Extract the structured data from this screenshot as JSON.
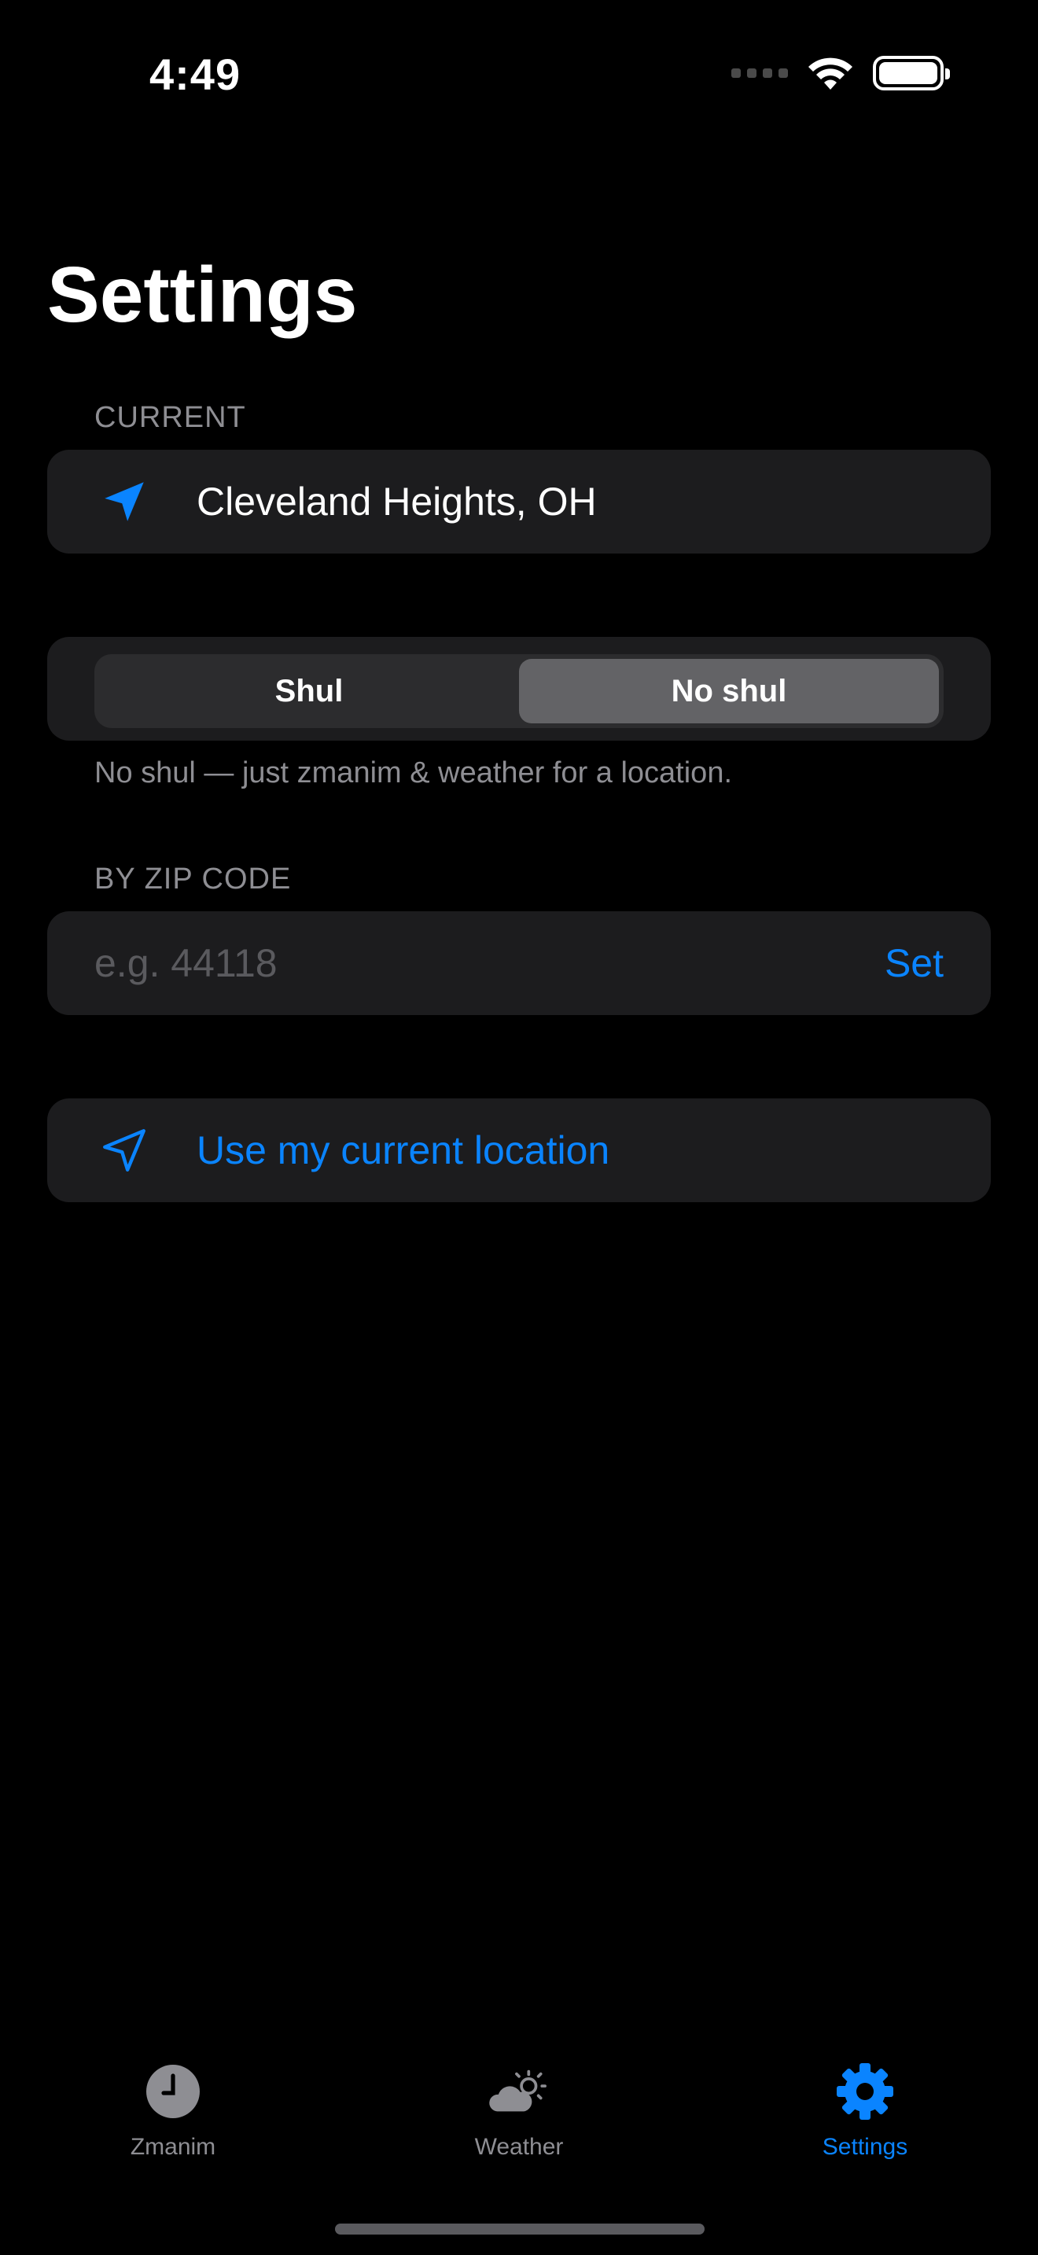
{
  "status_bar": {
    "time": "4:49"
  },
  "page": {
    "title": "Settings"
  },
  "current_section": {
    "label": "CURRENT",
    "location": "Cleveland Heights, OH",
    "icon": "location-arrow-filled-icon"
  },
  "mode": {
    "options": [
      "Shul",
      "No shul"
    ],
    "selected": "No shul",
    "helper": "No shul — just zmanim & weather for a location."
  },
  "zip_section": {
    "label": "BY ZIP CODE",
    "value": "",
    "placeholder": "e.g. 44118",
    "set_label": "Set"
  },
  "use_location": {
    "label": "Use my current location",
    "icon": "location-arrow-outline-icon"
  },
  "tabs": [
    {
      "label": "Zmanim",
      "icon": "clock-icon",
      "active": false
    },
    {
      "label": "Weather",
      "icon": "cloud-sun-icon",
      "active": false
    },
    {
      "label": "Settings",
      "icon": "gear-icon",
      "active": true
    }
  ],
  "colors": {
    "accent": "#0a84ff",
    "background": "#000000",
    "card": "#1c1c1e",
    "secondary_text": "#8e8e93"
  }
}
